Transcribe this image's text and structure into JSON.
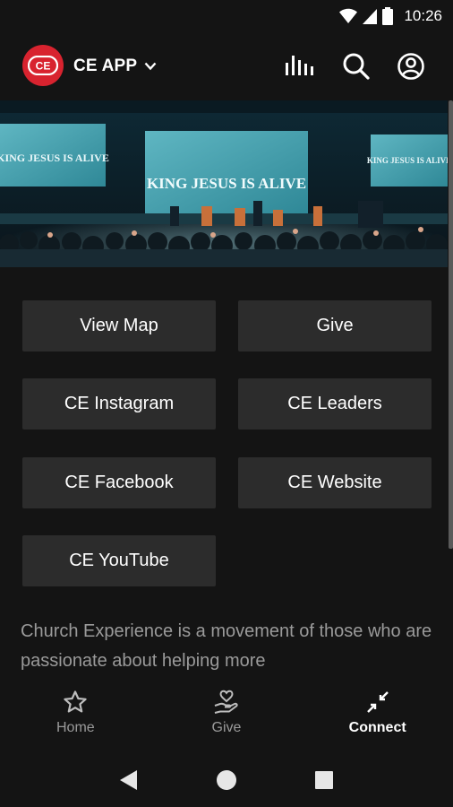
{
  "status": {
    "time": "10:26"
  },
  "header": {
    "logo_text": "CE",
    "title": "CE APP"
  },
  "hero": {
    "screen_text_center": "KING JESUS IS ALIVE",
    "screen_text_left": "KING JESUS IS ALIVE",
    "screen_text_right": "KING JESUS IS ALIVE"
  },
  "buttons": {
    "view_map": "View Map",
    "give": "Give",
    "instagram": "CE Instagram",
    "leaders": "CE Leaders",
    "facebook": "CE Facebook",
    "website": "CE Website",
    "youtube": "CE YouTube"
  },
  "description": "Church Experience is a movement of those who are passionate about helping more",
  "bottom_nav": {
    "home": "Home",
    "give": "Give",
    "connect": "Connect",
    "active": "connect"
  },
  "colors": {
    "brand": "#d8232f",
    "background": "#141414",
    "button": "#2c2c2c"
  }
}
